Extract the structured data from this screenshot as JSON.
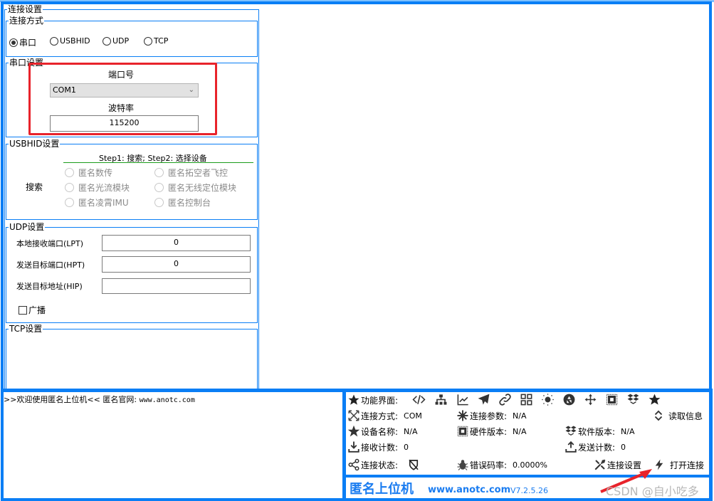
{
  "connection_settings": {
    "title": "连接设置",
    "mode_group": {
      "title": "连接方式",
      "options": [
        {
          "label": "串口",
          "selected": true
        },
        {
          "label": "USBHID",
          "selected": false
        },
        {
          "label": "UDP",
          "selected": false
        },
        {
          "label": "TCP",
          "selected": false
        }
      ]
    },
    "serial_group": {
      "title": "串口设置",
      "port_label": "端口号",
      "port_value": "COM1",
      "baud_label": "波特率",
      "baud_value": "115200"
    },
    "usbhid_group": {
      "title": "USBHID设置",
      "steps": "Step1: 搜索; Step2: 选择设备",
      "search_label": "搜索",
      "devices": [
        "匿名数传",
        "匿名拓空者飞控",
        "匿名光流模块",
        "匿名无线定位模块",
        "匿名凌霄IMU",
        "匿名控制台"
      ]
    },
    "udp_group": {
      "title": "UDP设置",
      "local_port_label": "本地接收端口(LPT)",
      "local_port_value": "0",
      "target_port_label": "发送目标端口(HPT)",
      "target_port_value": "0",
      "target_addr_label": "发送目标地址(HIP)",
      "target_addr_value": "",
      "broadcast_label": "广播",
      "broadcast_checked": false
    },
    "tcp_group": {
      "title": "TCP设置"
    }
  },
  "log": {
    "welcome": ">>欢迎使用匿名上位机<<   匿名官网: ",
    "url": "www.anotc.com"
  },
  "info_panel": {
    "function_label": "功能界面:",
    "toolbar_icons": [
      "code-icon",
      "sitemap-icon",
      "line-chart-icon",
      "paper-plane-icon",
      "link-icon",
      "grid-icon",
      "sun-icon",
      "aperture-icon",
      "move-arrows-icon",
      "chip-icon",
      "dropbox-icon",
      "star-icon"
    ],
    "rows": {
      "conn_mode_label": "连接方式:",
      "conn_mode_value": "COM",
      "conn_param_label": "连接参数:",
      "conn_param_value": "N/A",
      "read_info_label": "读取信息",
      "device_name_label": "设备名称:",
      "device_name_value": "N/A",
      "hw_version_label": "硬件版本:",
      "hw_version_value": "N/A",
      "sw_version_label": "软件版本:",
      "sw_version_value": "N/A",
      "rx_count_label": "接收计数:",
      "rx_count_value": "0",
      "tx_count_label": "发送计数:",
      "tx_count_value": "0",
      "conn_status_label": "连接状态:",
      "error_rate_label": "错误码率:",
      "error_rate_value": "0.0000%",
      "conn_settings_label": "连接设置",
      "open_conn_label": "打开连接"
    }
  },
  "brand": {
    "name": "匿名上位机",
    "url": "www.anotc.com",
    "version": "V7.2.5.26"
  },
  "watermark": "CSDN @自小吃多",
  "colors": {
    "frame_blue": "#0a7ef5",
    "highlight_red": "#e8232b",
    "brand_blue": "#1a7cf0"
  }
}
